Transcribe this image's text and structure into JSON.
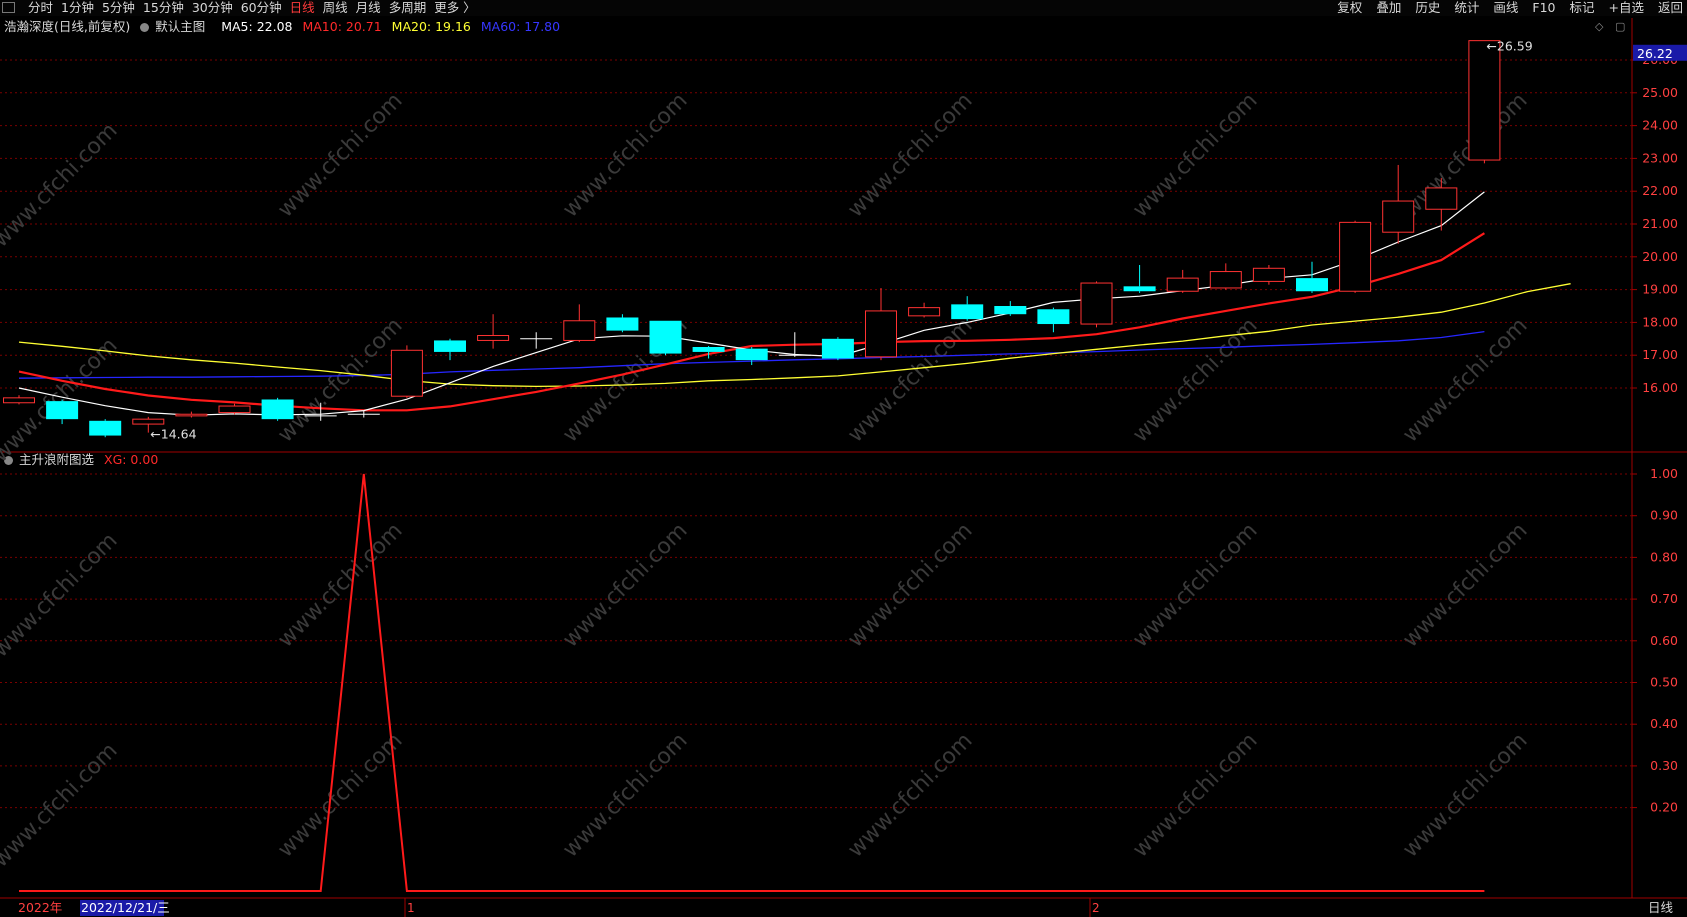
{
  "toolbar": {
    "tabs": [
      "分时",
      "1分钟",
      "5分钟",
      "15分钟",
      "30分钟",
      "60分钟",
      "日线",
      "周线",
      "月线",
      "多周期",
      "更多 〉"
    ],
    "active_tab": "日线",
    "tools": [
      "复权",
      "叠加",
      "历史",
      "统计",
      "画线",
      "F10",
      "标记",
      "+自选",
      "返回"
    ]
  },
  "main_legend": {
    "title": "浩瀚深度(日线,前复权)",
    "template": "默认主图",
    "ma5": "MA5: 22.08",
    "ma10": "MA10: 20.71",
    "ma20": "MA20: 19.16",
    "ma60": "MA60: 17.80"
  },
  "sub_legend": {
    "title": "主升浪附图选",
    "xg": "XG: 0.00"
  },
  "colors": {
    "up": "#ff3232",
    "down": "#00ffff",
    "ma5": "#ffffff",
    "ma10": "#ff1a1a",
    "ma20": "#ffff33",
    "ma60": "#2626ff",
    "grid": "#7a0000",
    "axis_text": "#ff4040",
    "signal": "#ff1a1a"
  },
  "bottom": {
    "year_label": "2022年",
    "cursor_date": "2022/12/21/三",
    "month_marks": [
      "1",
      "2"
    ],
    "period_label": "日线"
  },
  "watermark": "www.cfchi.com",
  "chart_data": [
    {
      "type": "candlestick",
      "title": "浩瀚深度(日线,前复权)",
      "ylim": [
        14.2,
        26.7
      ],
      "y_ticks": [
        16.0,
        17.0,
        18.0,
        19.0,
        20.0,
        21.0,
        22.0,
        23.0,
        24.0,
        25.0,
        26.0
      ],
      "y_tick_labels": [
        "16.00",
        "17.00",
        "18.00",
        "19.00",
        "20.00",
        "21.00",
        "22.00",
        "23.00",
        "24.00",
        "25.00",
        "26.00"
      ],
      "last_price_label": "26.22",
      "annotations": [
        {
          "text": "14.64",
          "kind": "low",
          "index": 3
        },
        {
          "text": "26.59",
          "kind": "high",
          "index": 34
        }
      ],
      "candles": [
        {
          "o": 15.55,
          "c": 15.7,
          "h": 15.78,
          "l": 15.5
        },
        {
          "o": 15.6,
          "c": 15.05,
          "h": 15.65,
          "l": 14.9
        },
        {
          "o": 15.0,
          "c": 14.55,
          "h": 15.05,
          "l": 14.5
        },
        {
          "o": 14.9,
          "c": 15.05,
          "h": 15.12,
          "l": 14.64
        },
        {
          "o": 15.15,
          "c": 15.2,
          "h": 15.28,
          "l": 15.1
        },
        {
          "o": 15.25,
          "c": 15.45,
          "h": 15.52,
          "l": 15.2
        },
        {
          "o": 15.65,
          "c": 15.05,
          "h": 15.7,
          "l": 15.0
        },
        {
          "o": 15.15,
          "c": 15.15,
          "h": 15.55,
          "l": 15.0
        },
        {
          "o": 15.2,
          "c": 15.2,
          "h": 15.3,
          "l": 15.1
        },
        {
          "o": 15.75,
          "c": 17.15,
          "h": 17.3,
          "l": 15.7
        },
        {
          "o": 17.45,
          "c": 17.1,
          "h": 17.5,
          "l": 16.85
        },
        {
          "o": 17.45,
          "c": 17.6,
          "h": 18.25,
          "l": 17.2
        },
        {
          "o": 17.5,
          "c": 17.5,
          "h": 17.7,
          "l": 17.2
        },
        {
          "o": 17.45,
          "c": 18.05,
          "h": 18.55,
          "l": 17.4
        },
        {
          "o": 18.15,
          "c": 17.75,
          "h": 18.25,
          "l": 17.7
        },
        {
          "o": 18.05,
          "c": 17.05,
          "h": 18.05,
          "l": 17.0
        },
        {
          "o": 17.25,
          "c": 17.1,
          "h": 17.28,
          "l": 16.9
        },
        {
          "o": 17.2,
          "c": 16.85,
          "h": 17.25,
          "l": 16.7
        },
        {
          "o": 17.0,
          "c": 17.0,
          "h": 17.7,
          "l": 16.95
        },
        {
          "o": 17.5,
          "c": 16.9,
          "h": 17.55,
          "l": 16.85
        },
        {
          "o": 16.95,
          "c": 18.35,
          "h": 19.05,
          "l": 16.85
        },
        {
          "o": 18.2,
          "c": 18.45,
          "h": 18.6,
          "l": 18.15
        },
        {
          "o": 18.55,
          "c": 18.1,
          "h": 18.8,
          "l": 18.05
        },
        {
          "o": 18.5,
          "c": 18.25,
          "h": 18.65,
          "l": 18.2
        },
        {
          "o": 18.4,
          "c": 17.95,
          "h": 18.45,
          "l": 17.7
        },
        {
          "o": 17.95,
          "c": 19.2,
          "h": 19.25,
          "l": 17.85
        },
        {
          "o": 19.1,
          "c": 18.95,
          "h": 19.75,
          "l": 18.9
        },
        {
          "o": 18.95,
          "c": 19.35,
          "h": 19.6,
          "l": 18.9
        },
        {
          "o": 19.05,
          "c": 19.55,
          "h": 19.8,
          "l": 19.0
        },
        {
          "o": 19.25,
          "c": 19.65,
          "h": 19.75,
          "l": 19.15
        },
        {
          "o": 19.35,
          "c": 18.95,
          "h": 19.85,
          "l": 18.9
        },
        {
          "o": 18.95,
          "c": 21.05,
          "h": 21.1,
          "l": 18.9
        },
        {
          "o": 20.75,
          "c": 21.7,
          "h": 22.8,
          "l": 20.4
        },
        {
          "o": 21.45,
          "c": 22.1,
          "h": 22.4,
          "l": 20.8
        },
        {
          "o": 22.95,
          "c": 26.59,
          "h": 26.59,
          "l": 22.85
        }
      ],
      "ma5": [
        16.0,
        15.72,
        15.46,
        15.25,
        15.17,
        15.21,
        15.18,
        15.2,
        15.31,
        15.66,
        16.16,
        16.66,
        17.08,
        17.5,
        17.59,
        17.58,
        17.37,
        17.16,
        17.02,
        16.96,
        17.34,
        17.76,
        18.0,
        18.29,
        18.61,
        18.72,
        18.8,
        18.97,
        19.13,
        19.34,
        19.45,
        19.9,
        20.45,
        20.95,
        21.98
      ],
      "ma10": [
        16.5,
        16.22,
        15.97,
        15.77,
        15.64,
        15.56,
        15.46,
        15.38,
        15.32,
        15.32,
        15.44,
        15.66,
        15.88,
        16.14,
        16.41,
        16.72,
        17.04,
        17.28,
        17.32,
        17.34,
        17.4,
        17.43,
        17.44,
        17.47,
        17.52,
        17.64,
        17.85,
        18.12,
        18.35,
        18.58,
        18.78,
        19.1,
        19.48,
        19.9,
        20.72
      ],
      "ma20": [
        17.4,
        17.27,
        17.13,
        16.98,
        16.86,
        16.76,
        16.64,
        16.53,
        16.39,
        16.23,
        16.12,
        16.07,
        16.05,
        16.06,
        16.09,
        16.14,
        16.22,
        16.26,
        16.31,
        16.37,
        16.49,
        16.62,
        16.75,
        16.91,
        17.05,
        17.18,
        17.31,
        17.43,
        17.59,
        17.73,
        17.92,
        18.04,
        18.16,
        18.31,
        18.59,
        18.94,
        19.18
      ],
      "ma60": [
        16.3,
        16.31,
        16.32,
        16.33,
        16.33,
        16.34,
        16.35,
        16.36,
        16.38,
        16.42,
        16.49,
        16.54,
        16.58,
        16.62,
        16.68,
        16.74,
        16.78,
        16.82,
        16.86,
        16.89,
        16.93,
        16.96,
        17.0,
        17.04,
        17.07,
        17.11,
        17.16,
        17.2,
        17.24,
        17.29,
        17.33,
        17.38,
        17.44,
        17.54,
        17.72
      ]
    },
    {
      "type": "line",
      "title": "主升浪附图选",
      "series": [
        {
          "name": "XG",
          "values": [
            0,
            0,
            0,
            0,
            0,
            0,
            0,
            0,
            1,
            0,
            0,
            0,
            0,
            0,
            0,
            0,
            0,
            0,
            0,
            0,
            0,
            0,
            0,
            0,
            0,
            0,
            0,
            0,
            0,
            0,
            0,
            0,
            0,
            0,
            0
          ]
        }
      ],
      "ylim": [
        0,
        1.05
      ],
      "y_ticks": [
        0.2,
        0.3,
        0.4,
        0.5,
        0.6,
        0.7,
        0.8,
        0.9,
        1.0
      ],
      "y_tick_labels": [
        "0.20",
        "0.30",
        "0.40",
        "0.50",
        "0.60",
        "0.70",
        "0.80",
        "0.90",
        "1.00"
      ]
    }
  ]
}
